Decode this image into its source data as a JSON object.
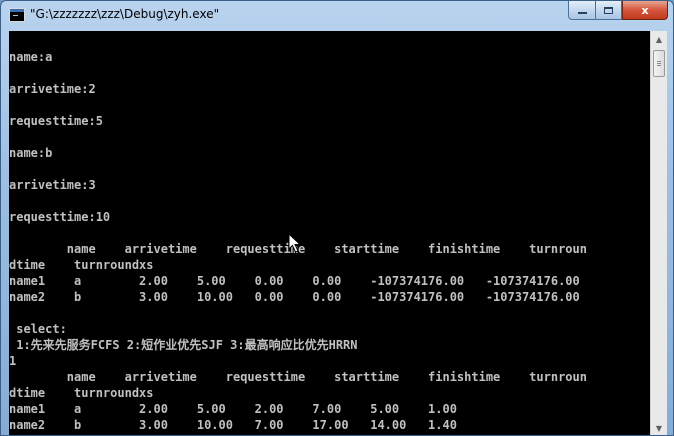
{
  "window": {
    "title": "\"G:\\zzzzzzz\\zzz\\Debug\\zyh.exe\""
  },
  "caption_buttons": {
    "close_glyph": "x",
    "minimize_icon": "minimize-icon",
    "maximize_icon": "maximize-icon"
  },
  "colors": {
    "console_bg": "#000000",
    "console_text": "#c0c0c0",
    "close_red": "#c23a1d",
    "titlebar_blue": "#9bbde2"
  },
  "console": {
    "lines": [
      "name:a",
      "arrivetime:2",
      "requesttime:5",
      "name:b",
      "arrivetime:3",
      "requesttime:10",
      "        name    arrivetime    requesttime    starttime    finishtime    turnroun",
      "dtime    turnroundxs",
      "name1    a        2.00    5.00    0.00    0.00    -107374176.00   -107374176.00",
      "name2    b        3.00    10.00   0.00    0.00    -107374176.00   -107374176.00",
      " select:",
      " 1:先来先服务FCFS 2:短作业优先SJF 3:最高响应比优先HRRN",
      "1",
      "        name    arrivetime    requesttime    starttime    finishtime    turnroun",
      "dtime    turnroundxs",
      "name1    a        2.00    5.00    2.00    7.00    5.00    1.00",
      "name2    b        3.00    10.00   7.00    17.00   14.00   1.40"
    ]
  },
  "scrollbar": {
    "up_glyph": "▲",
    "down_glyph": "▼"
  }
}
